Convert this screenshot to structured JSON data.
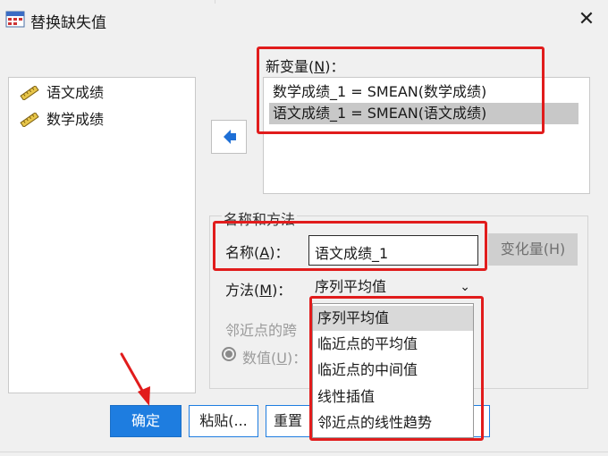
{
  "window": {
    "title": "替换缺失值",
    "close_glyph": "✕"
  },
  "variables": {
    "items": [
      {
        "label": "语文成绩",
        "icon": "scale-ruler-icon"
      },
      {
        "label": "数学成绩",
        "icon": "scale-ruler-icon"
      }
    ]
  },
  "new_variables": {
    "label_prefix": "新变量(",
    "label_key": "N",
    "label_suffix": ")：",
    "rows": [
      {
        "text": "数学成绩_1 = SMEAN(数学成绩)",
        "selected": false
      },
      {
        "text": "语文成绩_1 = SMEAN(语文成绩)",
        "selected": true
      }
    ]
  },
  "name_method": {
    "group_title": "名称和方法",
    "name_label_prefix": "名称(",
    "name_label_key": "A",
    "name_label_suffix": ")：",
    "name_value": "语文成绩_1",
    "change_button": "变化量(H)",
    "method_label_prefix": "方法(",
    "method_label_key": "M",
    "method_label_suffix": ")：",
    "method_selected": "序列平均值",
    "method_options": [
      {
        "label": "序列平均值",
        "selected": true
      },
      {
        "label": "临近点的平均值",
        "selected": false
      },
      {
        "label": "临近点的中间值",
        "selected": false
      },
      {
        "label": "线性插值",
        "selected": false
      },
      {
        "label": "邻近点的线性趋势",
        "selected": false
      }
    ],
    "span_label": "邻近点的跨",
    "value_label_prefix": "数值(",
    "value_label_key": "U",
    "value_label_suffix": ")："
  },
  "buttons": {
    "ok": "确定",
    "paste": "粘贴(...",
    "reset": "重置"
  },
  "colors": {
    "accent": "#1e7de0",
    "highlight": "#e11c1c",
    "selection": "#c8c8c8"
  }
}
